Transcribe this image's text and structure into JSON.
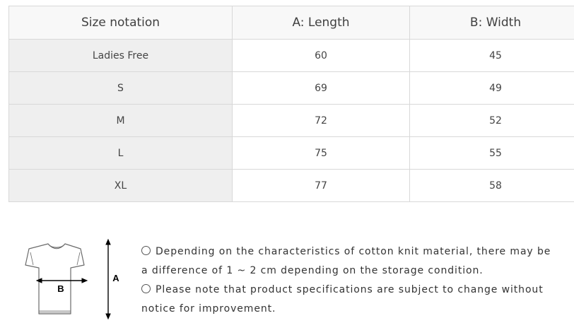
{
  "table": {
    "headers": [
      "Size notation",
      "A: Length",
      "B: Width"
    ],
    "rows": [
      [
        "Ladies Free",
        "60",
        "45"
      ],
      [
        "S",
        "69",
        "49"
      ],
      [
        "M",
        "72",
        "52"
      ],
      [
        "L",
        "75",
        "55"
      ],
      [
        "XL",
        "77",
        "58"
      ]
    ]
  },
  "illustration": {
    "label_a": "A",
    "label_b": "B"
  },
  "notes": {
    "line1": "Depending on the characteristics of cotton knit material, there may be",
    "line2": "a difference of 1 ~ 2 cm depending on the storage condition.",
    "line3": "Please note that product specifications are subject to change without",
    "line4": "notice for improvement."
  },
  "colors": {
    "table_border": "#d8d8d8",
    "header_background": "#f8f8f8",
    "size_label_background": "#efefef",
    "text": "#333333"
  }
}
